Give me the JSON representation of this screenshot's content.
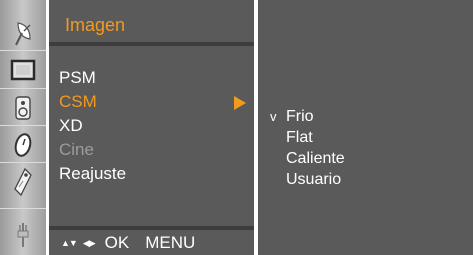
{
  "osd": {
    "title": "Imagen",
    "menu_items": [
      {
        "label": "PSM",
        "state": "normal"
      },
      {
        "label": "CSM",
        "state": "selected"
      },
      {
        "label": "XD",
        "state": "normal"
      },
      {
        "label": "Cine",
        "state": "disabled"
      },
      {
        "label": "Reajuste",
        "state": "normal"
      }
    ],
    "submenu": {
      "check_mark": "v",
      "items": [
        "Frio",
        "Flat",
        "Caliente",
        "Usuario"
      ],
      "checked_index": 0
    },
    "footer": {
      "updown_symbol": "▲▼",
      "leftright_symbol": "◀▶",
      "ok_label": "OK",
      "menu_label": "MENU"
    }
  },
  "side_icons": [
    "satellite-dish-icon",
    "screen-icon",
    "speaker-icon",
    "clock-icon",
    "tag-icon",
    "plug-icon"
  ],
  "colors": {
    "panel_background": "#5a5a5a",
    "accent_orange": "#f29a1d",
    "text_white": "#ffffff",
    "disabled_gray": "#9c9c9c"
  }
}
